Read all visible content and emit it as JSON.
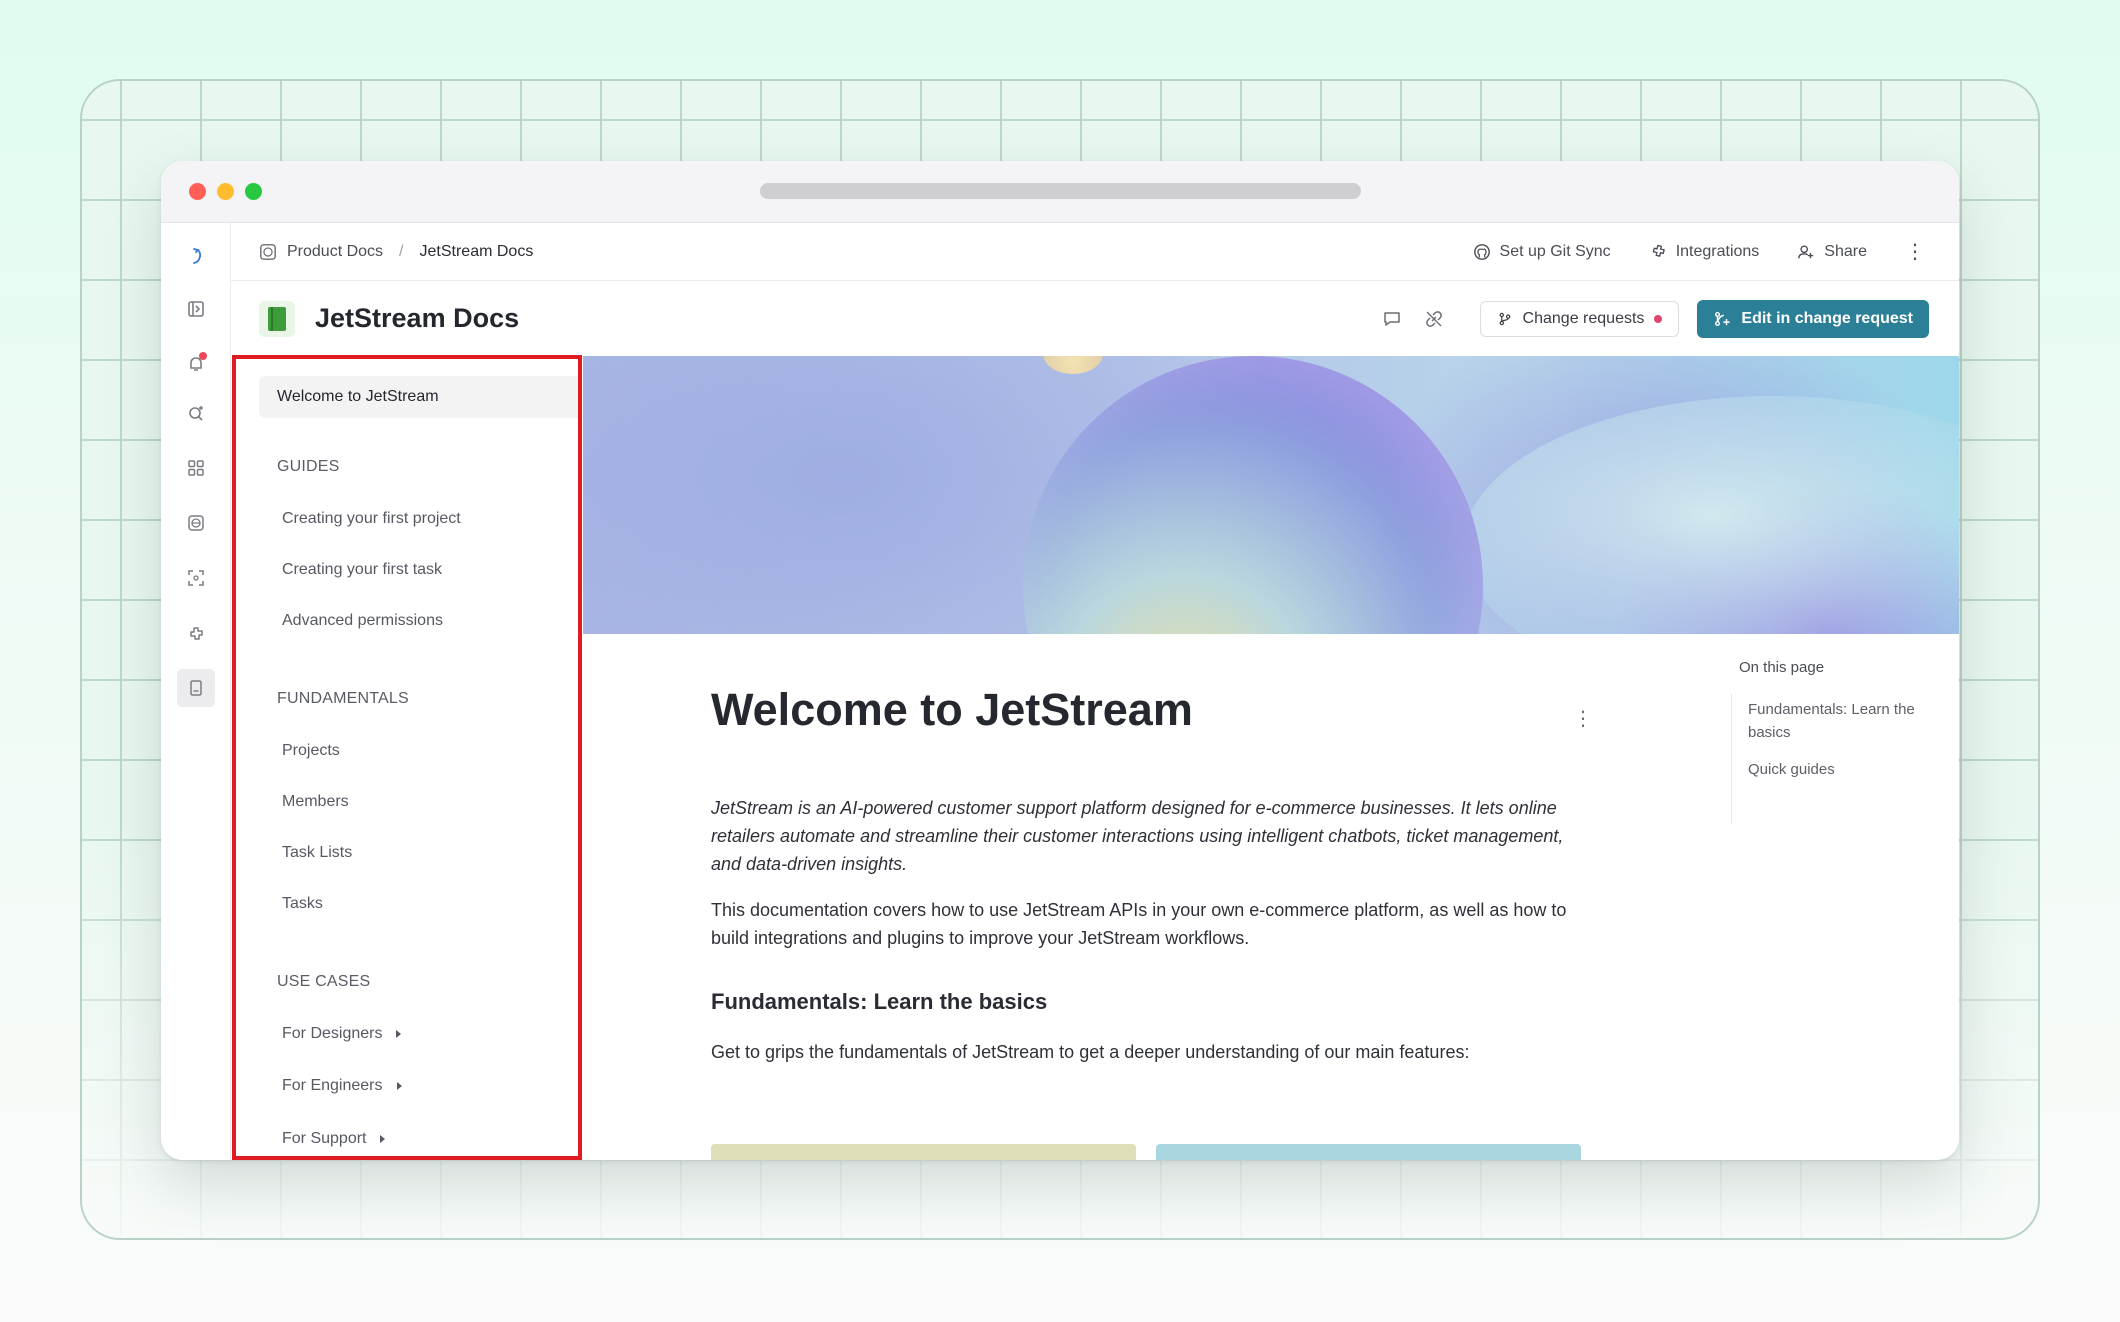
{
  "breadcrumb": {
    "root": "Product Docs",
    "separator": "/",
    "current": "JetStream Docs"
  },
  "top_actions": {
    "git_sync": "Set up Git Sync",
    "integrations": "Integrations",
    "share": "Share"
  },
  "header": {
    "title": "JetStream Docs",
    "change_requests": "Change requests",
    "edit_button": "Edit in change request"
  },
  "sidebar": {
    "top_item": "Welcome to JetStream",
    "sections": [
      {
        "title": "GUIDES",
        "items": [
          "Creating your first project",
          "Creating your first task",
          "Advanced permissions"
        ]
      },
      {
        "title": "FUNDAMENTALS",
        "items": [
          "Projects",
          "Members",
          "Task Lists",
          "Tasks"
        ]
      },
      {
        "title": "USE CASES",
        "items": [
          "For Designers",
          "For Engineers",
          "For Support"
        ]
      }
    ]
  },
  "page": {
    "title": "Welcome to JetStream",
    "intro": "JetStream is an AI-powered customer support platform designed for e-commerce businesses. It lets online retailers automate and streamline their customer interactions using intelligent chatbots, ticket management, and data-driven insights.",
    "body": "This documentation covers how to use JetStream APIs in your own e-commerce platform, as well as how to build integrations and plugins to improve your JetStream workflows.",
    "section_heading": "Fundamentals: Learn the basics",
    "section_text": "Get to grips the fundamentals of JetStream to get a deeper understanding of our main features:"
  },
  "toc": {
    "title": "On this page",
    "items": [
      "Fundamentals: Learn the basics",
      "Quick guides"
    ]
  },
  "icons": {
    "rail": [
      "logo-icon",
      "sidebar-toggle-icon",
      "notifications-icon",
      "search-icon",
      "apps-icon",
      "globe-icon",
      "scan-icon",
      "integrations-icon",
      "docs-icon"
    ]
  },
  "colors": {
    "primary": "#2b7f97",
    "highlight_outline": "#e01b24",
    "notification": "#f0475a"
  }
}
